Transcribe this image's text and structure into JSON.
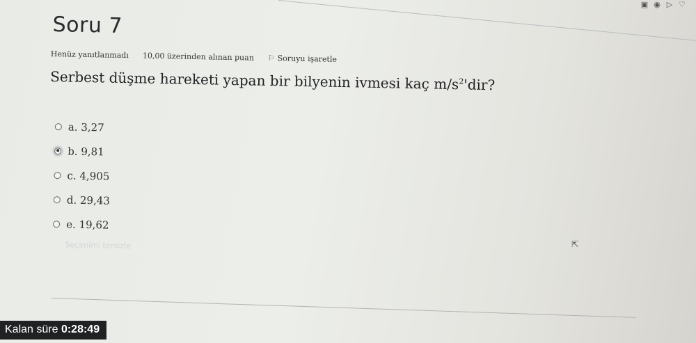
{
  "header": {
    "title": "Soru 7"
  },
  "info": {
    "status": "Henüz yanıtlanmadı",
    "points": "10,00 üzerinden alınan puan",
    "flag_label": "Soruyu işaretle"
  },
  "question": {
    "text": "Serbest düşme hareketi yapan bir bilyenin ivmesi kaç m/s",
    "sup": "2",
    "suffix": "'dir?"
  },
  "options": [
    {
      "label": "a. 3,27",
      "selected": false
    },
    {
      "label": "b. 9,81",
      "selected": true
    },
    {
      "label": "c. 4,905",
      "selected": false
    },
    {
      "label": "d. 29,43",
      "selected": false
    },
    {
      "label": "e. 19,62",
      "selected": false
    }
  ],
  "clear_choice": "Seçimimi temizle",
  "timer": {
    "label": "Kalan süre",
    "value": "0:28:49"
  },
  "top_icons": [
    "square-icon",
    "circle-icon",
    "play-icon",
    "heart-icon"
  ]
}
